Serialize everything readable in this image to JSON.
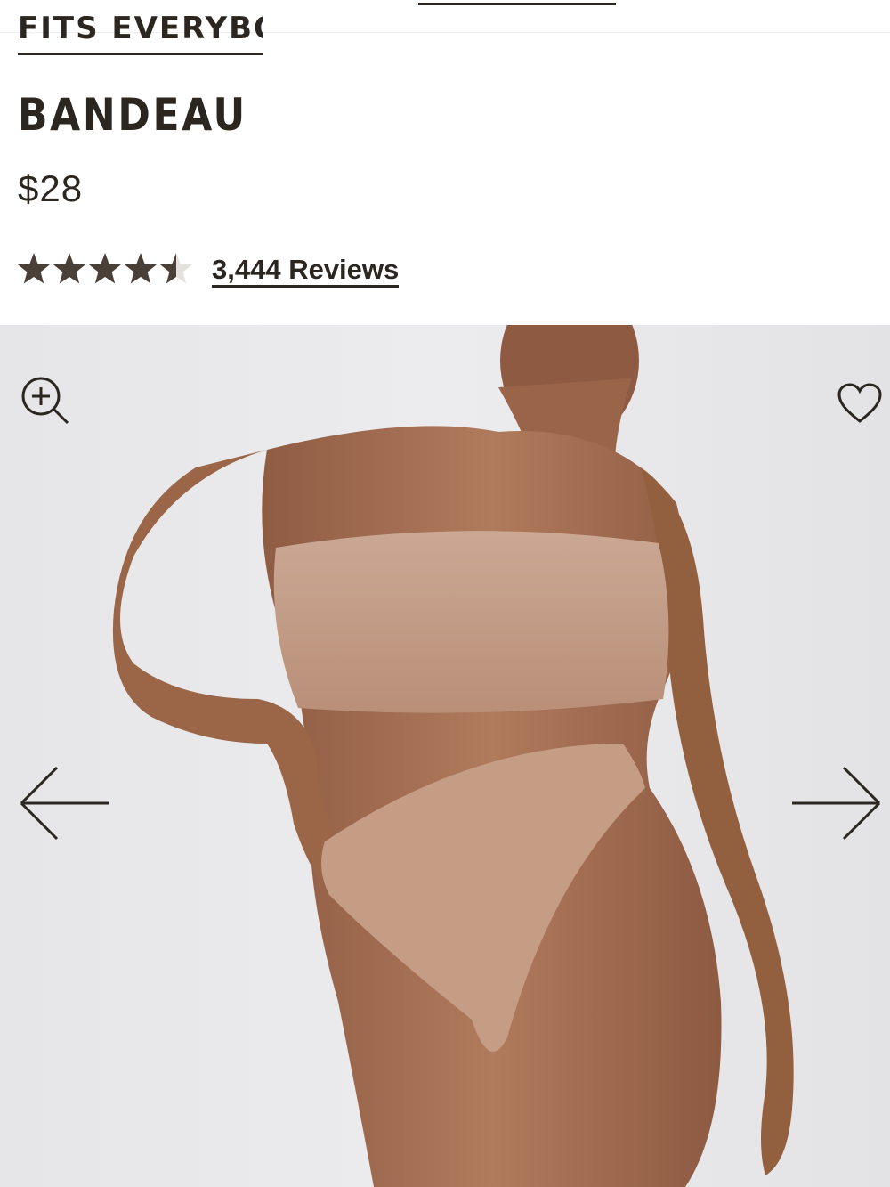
{
  "header": {
    "collection_link": "FITS EVERYBODY"
  },
  "product": {
    "title": "BANDEAU",
    "price": "$28",
    "rating": 4.5,
    "rating_max": 5,
    "reviews_label": "3,444 Reviews"
  },
  "gallery": {
    "image_label": "Model wearing bandeau top and brief",
    "icons": {
      "zoom": "zoom-in-icon",
      "favorite": "heart-icon",
      "previous": "arrow-left-icon",
      "next": "arrow-right-icon"
    }
  },
  "colors": {
    "text": "#2b2620",
    "star_filled": "#4a4038",
    "star_empty": "#e4e2df",
    "image_bg": "#e8e8ea",
    "fabric": "#c7a08a",
    "skin": "#a87256"
  }
}
